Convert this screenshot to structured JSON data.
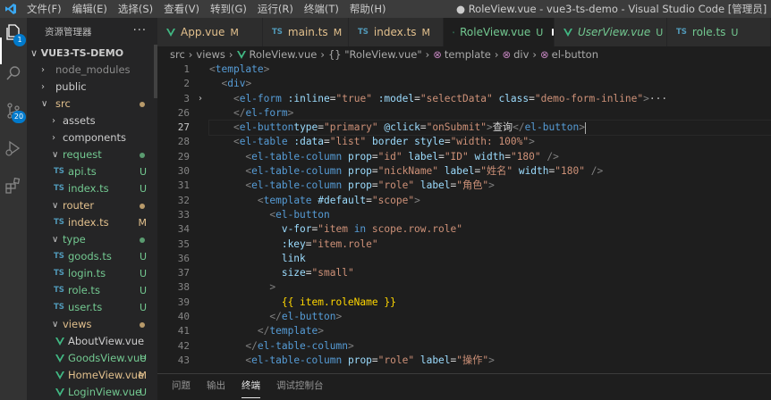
{
  "menu": [
    "文件(F)",
    "编辑(E)",
    "选择(S)",
    "查看(V)",
    "转到(G)",
    "运行(R)",
    "终端(T)",
    "帮助(H)"
  ],
  "window_title": "● RoleView.vue - vue3-ts-demo - Visual Studio Code [管理员]",
  "activity": {
    "explorer_badge": "1",
    "scm_badge": "20"
  },
  "sidebar": {
    "header": "资源管理器",
    "more": "···",
    "root": "VUE3-TS-DEMO",
    "items": [
      {
        "label": "node_modules",
        "status": ""
      },
      {
        "label": "public",
        "status": ""
      },
      {
        "label": "src",
        "status": ""
      },
      {
        "label": "assets",
        "status": ""
      },
      {
        "label": "components",
        "status": ""
      },
      {
        "label": "request",
        "status": ""
      },
      {
        "label": "api.ts",
        "status": "U",
        "icon": "TS"
      },
      {
        "label": "index.ts",
        "status": "U",
        "icon": "TS"
      },
      {
        "label": "router",
        "status": ""
      },
      {
        "label": "index.ts",
        "status": "M",
        "icon": "TS"
      },
      {
        "label": "type",
        "status": ""
      },
      {
        "label": "goods.ts",
        "status": "U",
        "icon": "TS"
      },
      {
        "label": "login.ts",
        "status": "U",
        "icon": "TS"
      },
      {
        "label": "role.ts",
        "status": "U",
        "icon": "TS"
      },
      {
        "label": "user.ts",
        "status": "U",
        "icon": "TS"
      },
      {
        "label": "views",
        "status": ""
      },
      {
        "label": "AboutView.vue",
        "status": ""
      },
      {
        "label": "GoodsView.vue",
        "status": "U"
      },
      {
        "label": "HomeView.vue",
        "status": "M"
      },
      {
        "label": "LoginView.vue",
        "status": "U"
      }
    ]
  },
  "tabs": [
    {
      "label": "App.vue",
      "status": "M",
      "icon": "vue"
    },
    {
      "label": "main.ts",
      "status": "M",
      "icon": "TS"
    },
    {
      "label": "index.ts",
      "status": "M",
      "icon": "TS"
    },
    {
      "label": "RoleView.vue",
      "status": "U",
      "icon": "vue"
    },
    {
      "label": "UserView.vue",
      "status": "U",
      "icon": "vue"
    },
    {
      "label": "role.ts",
      "status": "U",
      "icon": "TS"
    }
  ],
  "breadcrumb": [
    "src",
    "views",
    "RoleView.vue",
    "{} \"RoleView.vue\"",
    "template",
    "div",
    "el-button"
  ],
  "editor": {
    "line_numbers": [
      "1",
      "2",
      "3",
      "26",
      "27",
      "28",
      "29",
      "30",
      "31",
      "32",
      "33",
      "34",
      "35",
      "36",
      "37",
      "38",
      "39",
      "40",
      "41",
      "42",
      "43"
    ],
    "current_line": "27",
    "text": {
      "template": "template",
      "div": "div",
      "el_form": "el-form",
      "inline_attr": ":inline",
      "true_val": "\"true\"",
      "model_attr": ":model",
      "selectData_val": "\"selectData\"",
      "class_attr": "class",
      "class_val": "\"demo-form-inline\"",
      "ellipsis": "···",
      "el_button": "el-button",
      "type_attr": "type",
      "primary_val": "\"primary\"",
      "click_attr": "@click",
      "onSubmit_val": "\"onSubmit\"",
      "query_text": "查询",
      "el_table": "el-table",
      "data_attr": ":data",
      "list_val": "\"list\"",
      "border_attr": "border",
      "style_attr": "style",
      "style_val": "\"width: 100%\"",
      "el_table_column": "el-table-column",
      "prop_attr": "prop",
      "id_val": "\"id\"",
      "label_attr": "label",
      "ID_val": "\"ID\"",
      "width_attr": "width",
      "w180_val": "\"180\"",
      "nickName_val": "\"nickName\"",
      "name_label_val": "\"姓名\"",
      "role_val": "\"role\"",
      "role_label_val": "\"角色\"",
      "default_attr": "#default",
      "scope_val": "\"scope\"",
      "vfor_attr": "v-for",
      "vfor_val_1": "\"item ",
      "vfor_in": "in",
      "vfor_val_2": " scope.row.role\"",
      "key_attr": ":key",
      "item_role_val": "\"item.role\"",
      "link_attr": "link",
      "size_attr": "size",
      "small_val": "\"small\"",
      "interp": "{{ item.roleName }}",
      "action_label_val": "\"操作\""
    }
  },
  "panel_tabs": [
    "问题",
    "输出",
    "终端",
    "调试控制台"
  ],
  "colors": {
    "accent": "#007acc",
    "untracked": "#73c991",
    "modified": "#e2c08d"
  }
}
